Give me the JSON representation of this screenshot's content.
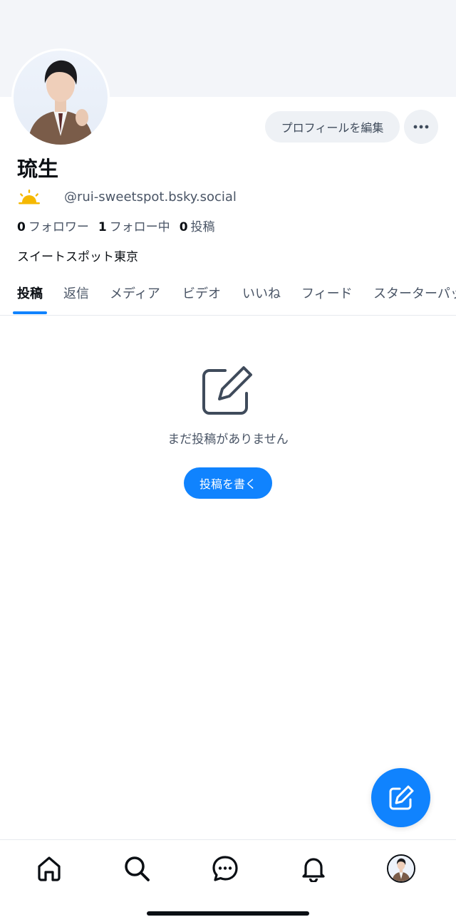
{
  "profile": {
    "display_name": "琉生",
    "handle": "@rui-sweetspot.bsky.social",
    "badge_icon": "sun-icon",
    "bio": "スイートスポット東京"
  },
  "actions": {
    "edit_profile_label": "プロフィールを編集",
    "more_icon": "ellipsis-icon"
  },
  "stats": [
    {
      "count": "0",
      "label": "フォロワー"
    },
    {
      "count": "1",
      "label": "フォロー中"
    },
    {
      "count": "0",
      "label": "投稿"
    }
  ],
  "tabs": [
    {
      "label": "投稿",
      "active": true
    },
    {
      "label": "返信"
    },
    {
      "label": "メディア"
    },
    {
      "label": "ビデオ"
    },
    {
      "label": "いいね"
    },
    {
      "label": "フィード"
    },
    {
      "label": "スターターパック"
    }
  ],
  "empty_state": {
    "icon": "edit-icon",
    "message": "まだ投稿がありません",
    "button_label": "投稿を書く"
  },
  "bottom_nav": [
    {
      "icon": "home-icon"
    },
    {
      "icon": "search-icon"
    },
    {
      "icon": "chat-icon"
    },
    {
      "icon": "bell-icon"
    },
    {
      "icon": "profile-avatar"
    }
  ],
  "colors": {
    "accent": "#1083fe",
    "banner": "#f3f5f9",
    "muted_text": "#4a5566"
  }
}
